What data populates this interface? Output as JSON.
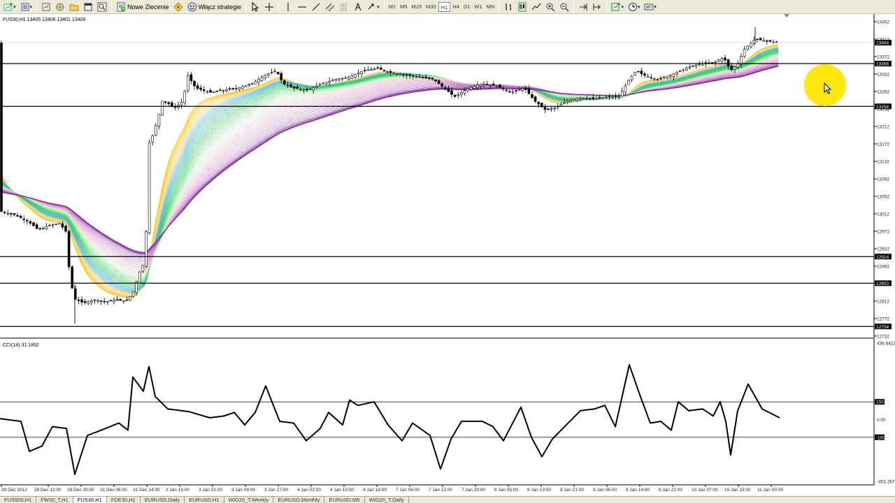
{
  "toolbar": {
    "new_order_label": "Nowe Zlecenie",
    "autotrade_label": "Włącz strategie",
    "timeframes": [
      "M1",
      "M5",
      "M15",
      "M30",
      "H1",
      "H4",
      "D1",
      "W1",
      "MN"
    ],
    "active_timeframe": "H1"
  },
  "chart": {
    "header": "FUS30,H1  13405 13406 13401 13404",
    "indicator_header": "CCI(14) 31.1892",
    "price_labels": [
      "13452",
      "13412",
      "13372",
      "13332",
      "13292",
      "13252",
      "13212",
      "13172",
      "13132",
      "13092",
      "13052",
      "13012",
      "12972",
      "12932",
      "12892",
      "12852",
      "12812",
      "12772",
      "12732"
    ],
    "badges": [
      {
        "label": "13404",
        "color": "#000000",
        "text_color": "#ffffff"
      },
      {
        "label": "13356",
        "color": "#000000",
        "text_color": "#ffffff"
      },
      {
        "label": "13258",
        "color": "#000000",
        "text_color": "#ffffff"
      },
      {
        "label": "12914",
        "color": "#000000",
        "text_color": "#ffffff"
      },
      {
        "label": "12853",
        "color": "#000000",
        "text_color": "#ffffff"
      },
      {
        "label": "12754",
        "color": "#000000",
        "text_color": "#ffffff"
      }
    ],
    "cci_labels": [
      "436.6422",
      "100",
      "0.00",
      "-100",
      "-353.2677"
    ],
    "time_labels": [
      "28 Dec 2012",
      "28 Dec 12:00",
      "28 Dec 20:00",
      "31 Dec 06:00",
      "31 Dec 14:00",
      "2 Jan 16:00",
      "3 Jan 01:00",
      "3 Jan 09:00",
      "3 Jan 17:00",
      "4 Jan 02:00",
      "4 Jan 10:00",
      "4 Jan 18:00",
      "7 Jan 04:00",
      "7 Jan 12:00",
      "7 Jan 20:00",
      "8 Jan 05:00",
      "8 Jan 13:00",
      "8 Jan 21:00",
      "9 Jan 06:00",
      "9 Jan 14:00",
      "9 Jan 22:00",
      "10 Jan 07:00",
      "10 Jan 15:00",
      "11 Jan 00:00"
    ]
  },
  "tabs": [
    "FUS500,H1",
    "FW20_T,H1",
    "FUS30,H1",
    "FDE30,H1",
    "EURUSD,Daily",
    "EURUSD,H1",
    "WIG20_T,Weekly",
    "EURUSD,Monthly",
    "EURUSD,M5",
    "WIG20_T,Daily"
  ],
  "active_tab": "FUS30,H1",
  "colors": {
    "ribbon_fast": "#f2c21a",
    "ribbon_mid1": "#4fb3e0",
    "ribbon_mid2": "#2fd24f",
    "ribbon_slow1": "#f4b3cf",
    "ribbon_slow2": "#7a2a9a",
    "cursor_highlight": "#ffe600"
  }
}
